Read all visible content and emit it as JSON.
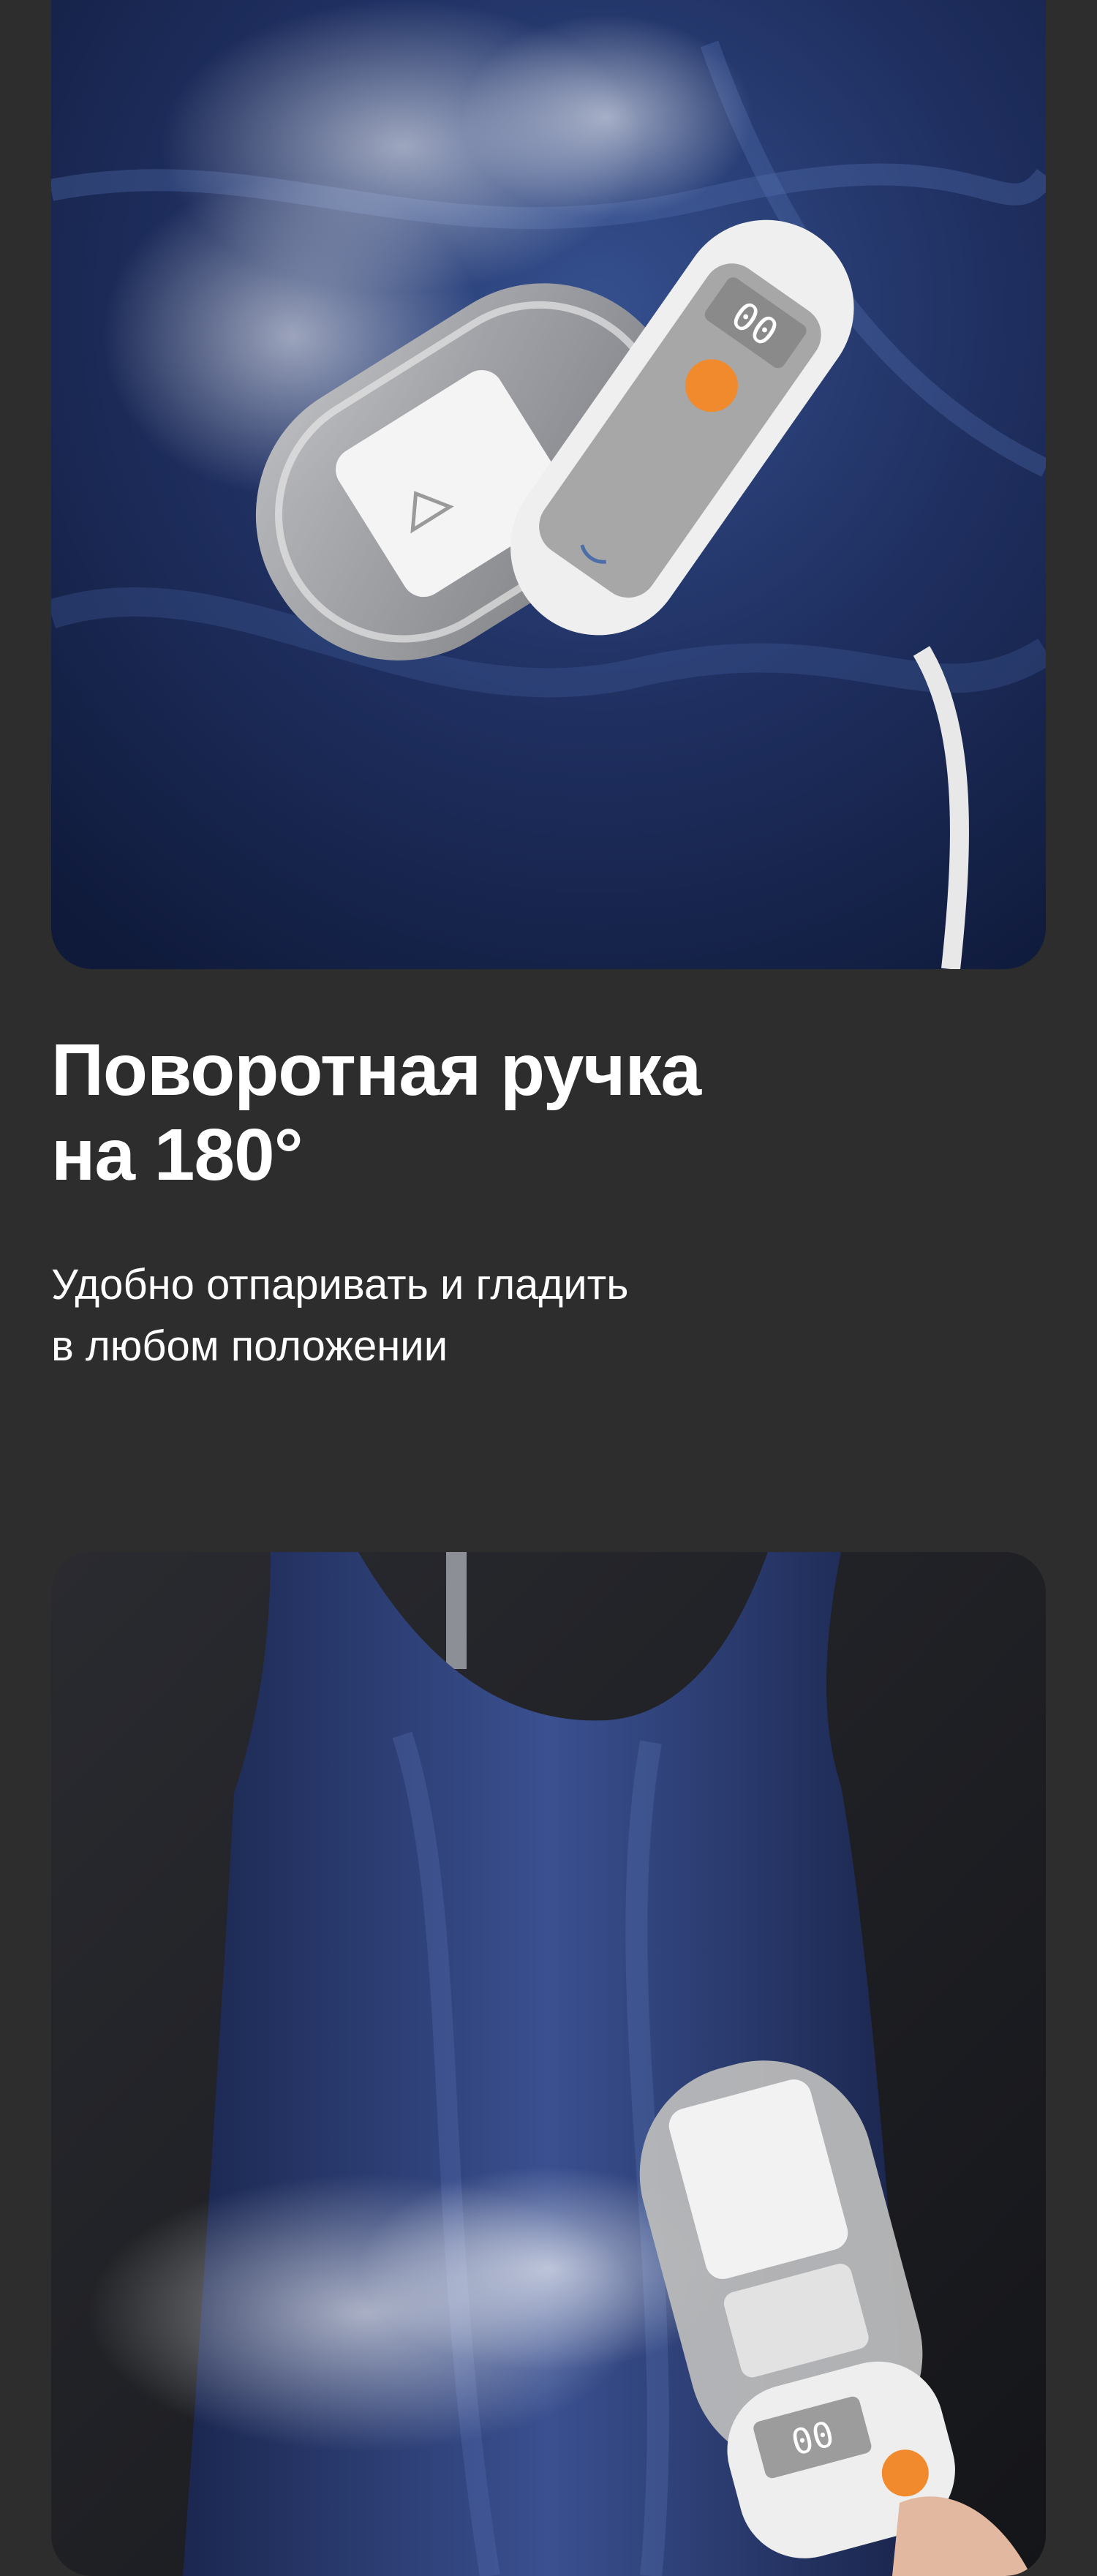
{
  "heading": {
    "line1": "Поворотная ручка",
    "line2": "на 180°"
  },
  "subtitle": {
    "line1": "Удобно отпаривать и гладить",
    "line2": "в любом положении"
  },
  "display": {
    "top_digits": "00",
    "bottom_digits": "00"
  },
  "colors": {
    "page_background": "#2d2d2d",
    "fabric_navy": "#1c2a55",
    "button_accent": "#f08a2c",
    "device_white": "#eeeeee"
  },
  "images": {
    "top": "steamer-on-navy-satin-icon",
    "bottom": "steamer-on-hanging-dress-icon"
  }
}
